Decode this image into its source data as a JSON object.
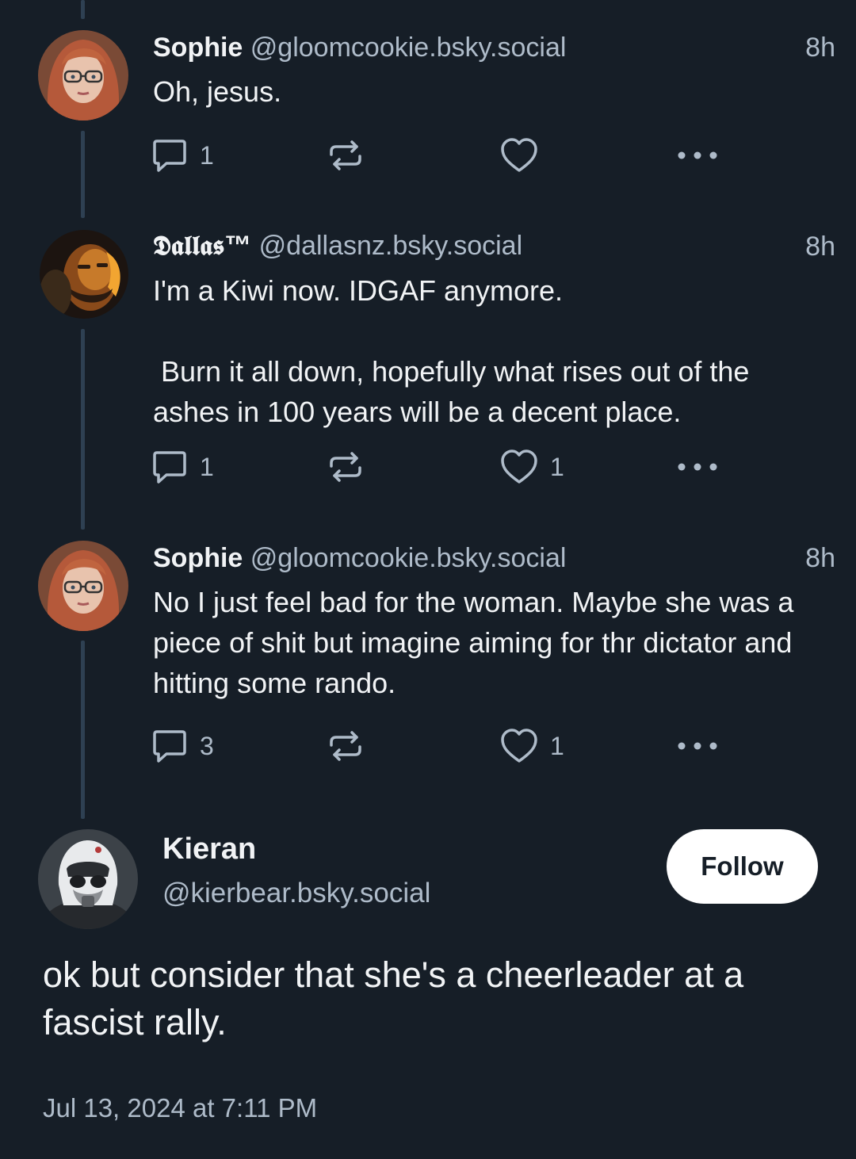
{
  "thread": [
    {
      "author_name": "Sophie",
      "author_handle": "@gloomcookie.bsky.social",
      "time": "8h",
      "text": "Oh, jesus.",
      "reply_count": "1",
      "repost_count": "",
      "like_count": ""
    },
    {
      "author_name": "𝕯𝖆𝖑𝖑𝖆𝖘™",
      "author_handle": "@dallasnz.bsky.social",
      "time": "8h",
      "text": "I'm a Kiwi now. IDGAF anymore.\n\n Burn it all down, hopefully what rises out of the ashes in 100 years will be a decent place.",
      "reply_count": "1",
      "repost_count": "",
      "like_count": "1"
    },
    {
      "author_name": "Sophie",
      "author_handle": "@gloomcookie.bsky.social",
      "time": "8h",
      "text": "No I just feel bad for the woman. Maybe she was a piece of shit but imagine aiming for thr dictator and hitting some rando.",
      "reply_count": "3",
      "repost_count": "",
      "like_count": "1"
    }
  ],
  "main_post": {
    "author_name": "Kieran",
    "author_handle": "@kierbear.bsky.social",
    "follow_label": "Follow",
    "text": "ok but consider that she's a cheerleader at a fascist rally.",
    "date": "Jul 13, 2024 at 7:11 PM"
  },
  "icons": {
    "reply": "speech-bubble-icon",
    "repost": "repost-arrows-icon",
    "like": "heart-outline-icon",
    "more": "ellipsis-icon"
  },
  "colors": {
    "background": "#161e27",
    "text_primary": "#f1f3f5",
    "text_secondary": "#aebbc9",
    "thread_line": "#2e4052",
    "follow_button": "#ffffff"
  }
}
